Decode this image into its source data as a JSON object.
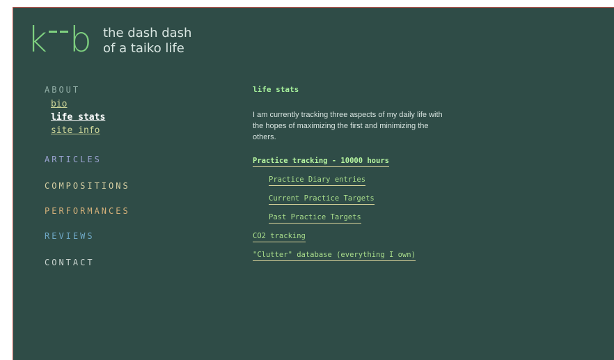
{
  "header": {
    "logo_k": "k",
    "logo_b": "b",
    "tagline_line1": "the dash dash",
    "tagline_line2": "of a taiko life"
  },
  "nav": {
    "about": "ABOUT",
    "about_items": [
      "bio",
      "life stats",
      "site info"
    ],
    "articles": "ARTICLES",
    "compositions": "COMPOSITIONS",
    "performances": "PERFORMANCES",
    "reviews": "REVIEWS",
    "contact": "CONTACT"
  },
  "main": {
    "title": "life stats",
    "intro": "I am currently tracking three aspects of my daily life with the hopes of maximizing the first and minimizing the others.",
    "links": {
      "practice_tracking": "Practice tracking - 10000 hours",
      "practice_diary": "Practice Diary entries",
      "current_targets": "Current Practice Targets",
      "past_targets": "Past Practice Targets",
      "co2": "CO2 tracking",
      "clutter": "\"Clutter\" database (everything I own)"
    }
  },
  "colors": {
    "background": "#2f4c47",
    "logo": "#7ed07f",
    "accent_link": "#a9dd8b"
  }
}
